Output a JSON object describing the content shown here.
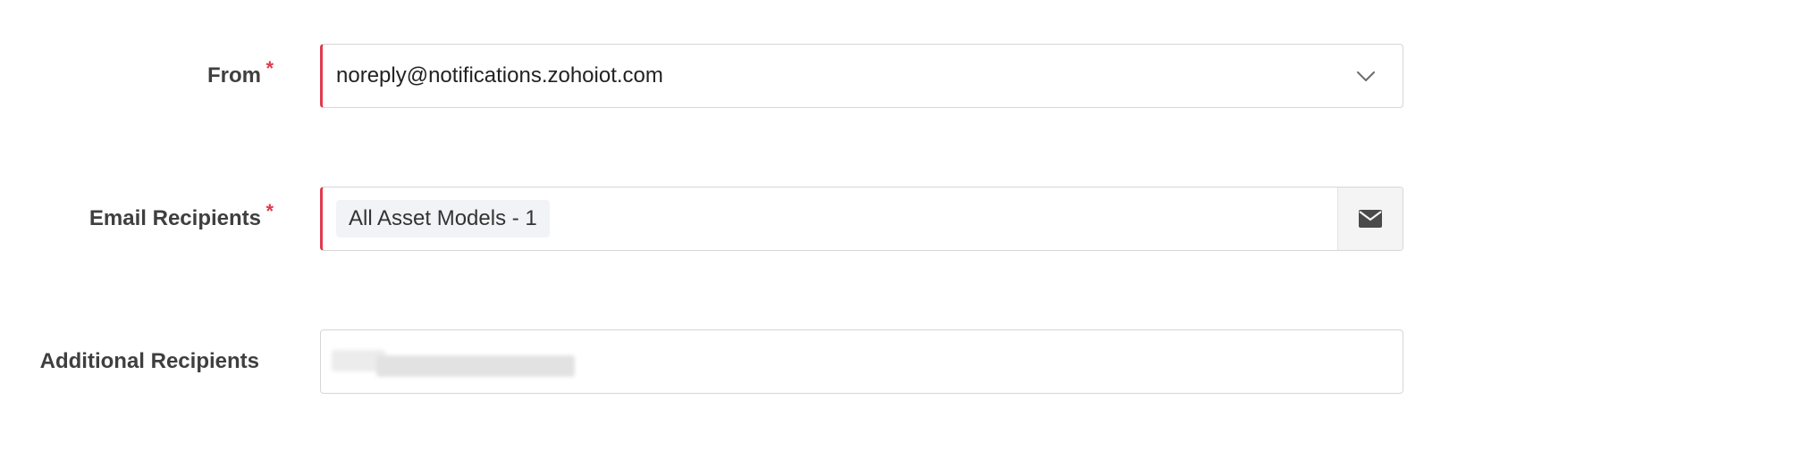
{
  "form": {
    "from": {
      "label": "From",
      "required_mark": "*",
      "value": "noreply@notifications.zohoiot.com",
      "dropdown_icon": "chevron-down-icon"
    },
    "email_recipients": {
      "label": "Email Recipients",
      "required_mark": "*",
      "tags": [
        "All Asset Models - 1"
      ],
      "addon_icon": "envelope-icon"
    },
    "additional_recipients": {
      "label": "Additional Recipients",
      "value_redacted": true
    }
  },
  "colors": {
    "required_accent": "#e03a4d",
    "label_text": "#3f3f3f",
    "field_border": "#d6d6d6",
    "tag_background": "#f2f3f7",
    "addon_background": "#f4f4f4"
  }
}
